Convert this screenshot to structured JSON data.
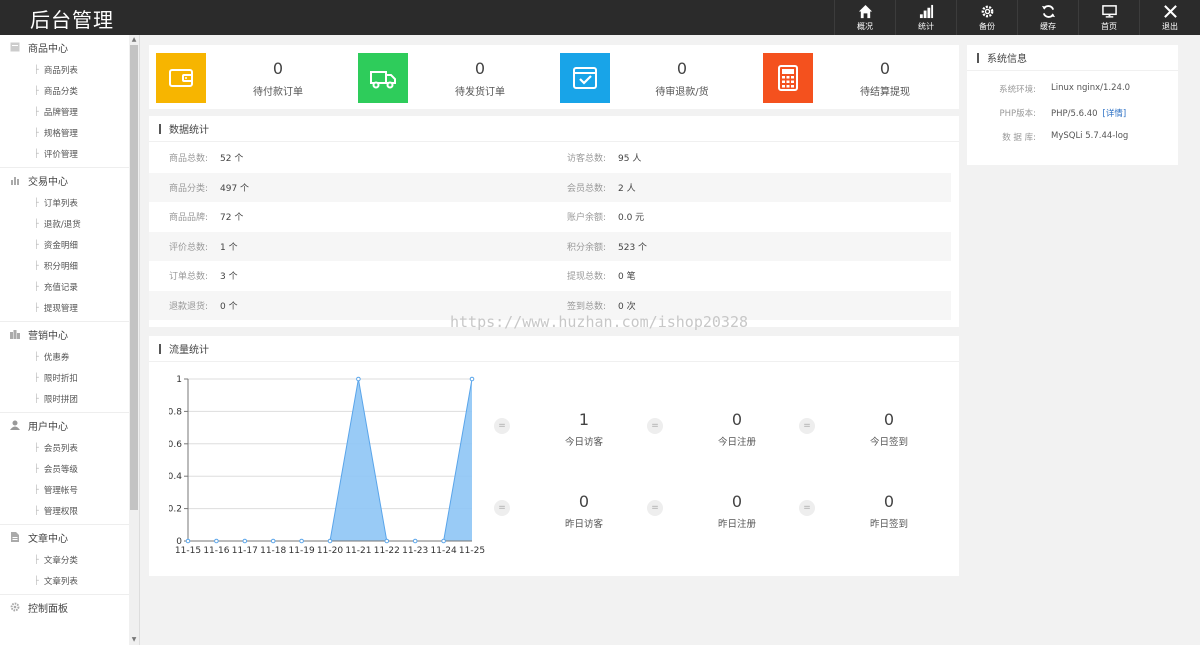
{
  "app": {
    "logo": "后台管理"
  },
  "topnav": [
    {
      "label": "概况",
      "icon": "home-icon"
    },
    {
      "label": "统计",
      "icon": "bar-chart-icon"
    },
    {
      "label": "备份",
      "icon": "gear-icon"
    },
    {
      "label": "缓存",
      "icon": "refresh-icon"
    },
    {
      "label": "首页",
      "icon": "monitor-icon"
    },
    {
      "label": "退出",
      "icon": "close-icon"
    }
  ],
  "sidebar": {
    "groups": [
      {
        "title": "商品中心",
        "icon": "goods-icon",
        "items": [
          "商品列表",
          "商品分类",
          "品牌管理",
          "规格管理",
          "评价管理"
        ]
      },
      {
        "title": "交易中心",
        "icon": "trade-icon",
        "items": [
          "订单列表",
          "退款/退货",
          "资金明细",
          "积分明细",
          "充值记录",
          "提现管理"
        ]
      },
      {
        "title": "营销中心",
        "icon": "marketing-icon",
        "items": [
          "优惠券",
          "限时折扣",
          "限时拼团"
        ]
      },
      {
        "title": "用户中心",
        "icon": "user-icon",
        "items": [
          "会员列表",
          "会员等级",
          "管理帐号",
          "管理权限"
        ]
      },
      {
        "title": "文章中心",
        "icon": "article-icon",
        "items": [
          "文章分类",
          "文章列表"
        ]
      },
      {
        "title": "控制面板",
        "icon": "settings-icon",
        "items": []
      }
    ]
  },
  "stats": [
    {
      "value": "0",
      "label": "待付款订单",
      "color": "#f7b500",
      "icon": "wallet-icon"
    },
    {
      "value": "0",
      "label": "待发货订单",
      "color": "#2ecc5b",
      "icon": "truck-icon"
    },
    {
      "value": "0",
      "label": "待审退款/货",
      "color": "#18a4e8",
      "icon": "box-check-icon"
    },
    {
      "value": "0",
      "label": "待结算提现",
      "color": "#f4511e",
      "icon": "calculator-icon"
    }
  ],
  "data_stats": {
    "title": "数据统计",
    "rows": [
      {
        "l_label": "商品总数:",
        "l_value": "52 个",
        "r_label": "访客总数:",
        "r_value": "95 人"
      },
      {
        "l_label": "商品分类:",
        "l_value": "497 个",
        "r_label": "会员总数:",
        "r_value": "2 人"
      },
      {
        "l_label": "商品品牌:",
        "l_value": "72 个",
        "r_label": "账户余额:",
        "r_value": "0.0 元"
      },
      {
        "l_label": "评价总数:",
        "l_value": "1 个",
        "r_label": "积分余额:",
        "r_value": "523 个"
      },
      {
        "l_label": "订单总数:",
        "l_value": "3 个",
        "r_label": "提现总数:",
        "r_value": "0 笔"
      },
      {
        "l_label": "退款退货:",
        "l_value": "0 个",
        "r_label": "签到总数:",
        "r_value": "0 次"
      }
    ]
  },
  "traffic": {
    "title": "流量统计",
    "stats": [
      {
        "value": "1",
        "label": "今日访客"
      },
      {
        "value": "0",
        "label": "今日注册"
      },
      {
        "value": "0",
        "label": "今日签到"
      },
      {
        "value": "0",
        "label": "昨日访客"
      },
      {
        "value": "0",
        "label": "昨日注册"
      },
      {
        "value": "0",
        "label": "昨日签到"
      }
    ],
    "eq_symbol": "="
  },
  "chart_data": {
    "type": "area",
    "x": [
      "11-15",
      "11-16",
      "11-17",
      "11-18",
      "11-19",
      "11-20",
      "11-21",
      "11-22",
      "11-23",
      "11-24",
      "11-25"
    ],
    "values": [
      0,
      0,
      0,
      0,
      0,
      0,
      1,
      0,
      0,
      0,
      1
    ],
    "yticks": [
      "0",
      "0.2",
      "0.4",
      "0.6",
      "0.8",
      "1"
    ],
    "ylim": [
      0,
      1
    ],
    "grid": true,
    "fill_color": "#8ec5f5",
    "line_color": "#5aa5ea"
  },
  "system": {
    "title": "系统信息",
    "rows": [
      {
        "label": "系统环境:",
        "value": "Linux nginx/1.24.0",
        "link": ""
      },
      {
        "label": "PHP版本:",
        "value": "PHP/5.6.40",
        "link": "[详情]"
      },
      {
        "label": "数 据 库:",
        "value": "MySQLi 5.7.44-log",
        "link": ""
      }
    ]
  },
  "watermark": "https://www.huzhan.com/ishop20328"
}
